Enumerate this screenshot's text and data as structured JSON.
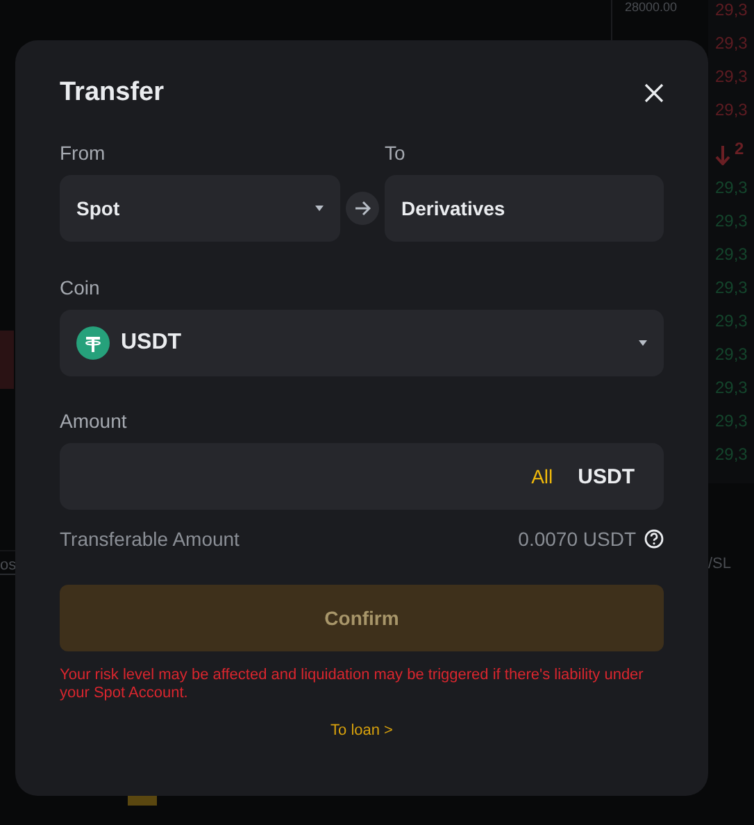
{
  "background": {
    "price_axis_label": "28000.00",
    "order_book": {
      "asks": [
        "29,3",
        "29,3",
        "29,3",
        "29,3"
      ],
      "last_price": "2",
      "bids": [
        "29,3",
        "29,3",
        "29,3",
        "29,3",
        "29,3",
        "29,3",
        "29,3",
        "29,3",
        "29,3"
      ]
    },
    "tab_fragment_left": "os",
    "tab_fragment_right": "/SL"
  },
  "dialog": {
    "title": "Transfer",
    "from": {
      "label": "From",
      "value": "Spot"
    },
    "to": {
      "label": "To",
      "value": "Derivatives"
    },
    "coin": {
      "label": "Coin",
      "value": "USDT"
    },
    "amount": {
      "label": "Amount",
      "all_button": "All",
      "unit": "USDT"
    },
    "transferable": {
      "label": "Transferable Amount",
      "value": "0.0070 USDT"
    },
    "confirm": {
      "label": "Confirm",
      "disabled": true
    },
    "warning": "Your risk level may be affected and liquidation may be triggered if there's liability under your Spot Account.",
    "loan_link": "To loan >"
  }
}
